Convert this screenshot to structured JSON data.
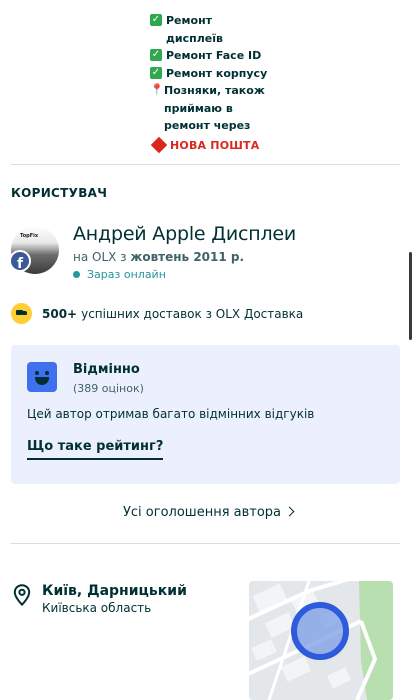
{
  "description": {
    "lines": [
      {
        "icon": "check-icon",
        "text": "Ремонт дисплеїв"
      },
      {
        "icon": "check-icon",
        "text": "Ремонт Face ID"
      },
      {
        "icon": "check-icon",
        "text": "Ремонт корпусу"
      }
    ],
    "note_icon": "pin-icon",
    "note_text": "Позняки, також приймаю в ремонт через",
    "carrier_logo": "НОВА ПОШТА"
  },
  "user": {
    "section_title": "КОРИСТУВАЧ",
    "avatar_brand": "TopFix",
    "facebook_badge": "f",
    "name": "Андрей Apple Дисплеи",
    "since_prefix": "на OLX з",
    "since_date": "жовтень 2011 р.",
    "online_status": "Зараз онлайн"
  },
  "delivery": {
    "count": "500+",
    "text": "успішних доставок з OLX Доставка"
  },
  "rating": {
    "title": "Відмінно",
    "count": "(389 оцінок)",
    "description": "Цей автор отримав багато відмінних відгуків",
    "link": "Що таке рейтинг?"
  },
  "all_ads_link": "Усі оголошення автора",
  "location": {
    "city": "Київ, Дарницький",
    "region": "Київська область"
  },
  "colors": {
    "primary_text": "#002f34",
    "accent_teal": "#23979c",
    "rating_bg": "#ebf0fc",
    "rating_face": "#3f70ed",
    "delivery_yellow": "#ffce32",
    "check_green": "#2fa84f",
    "nova_poshta_red": "#da291c"
  }
}
